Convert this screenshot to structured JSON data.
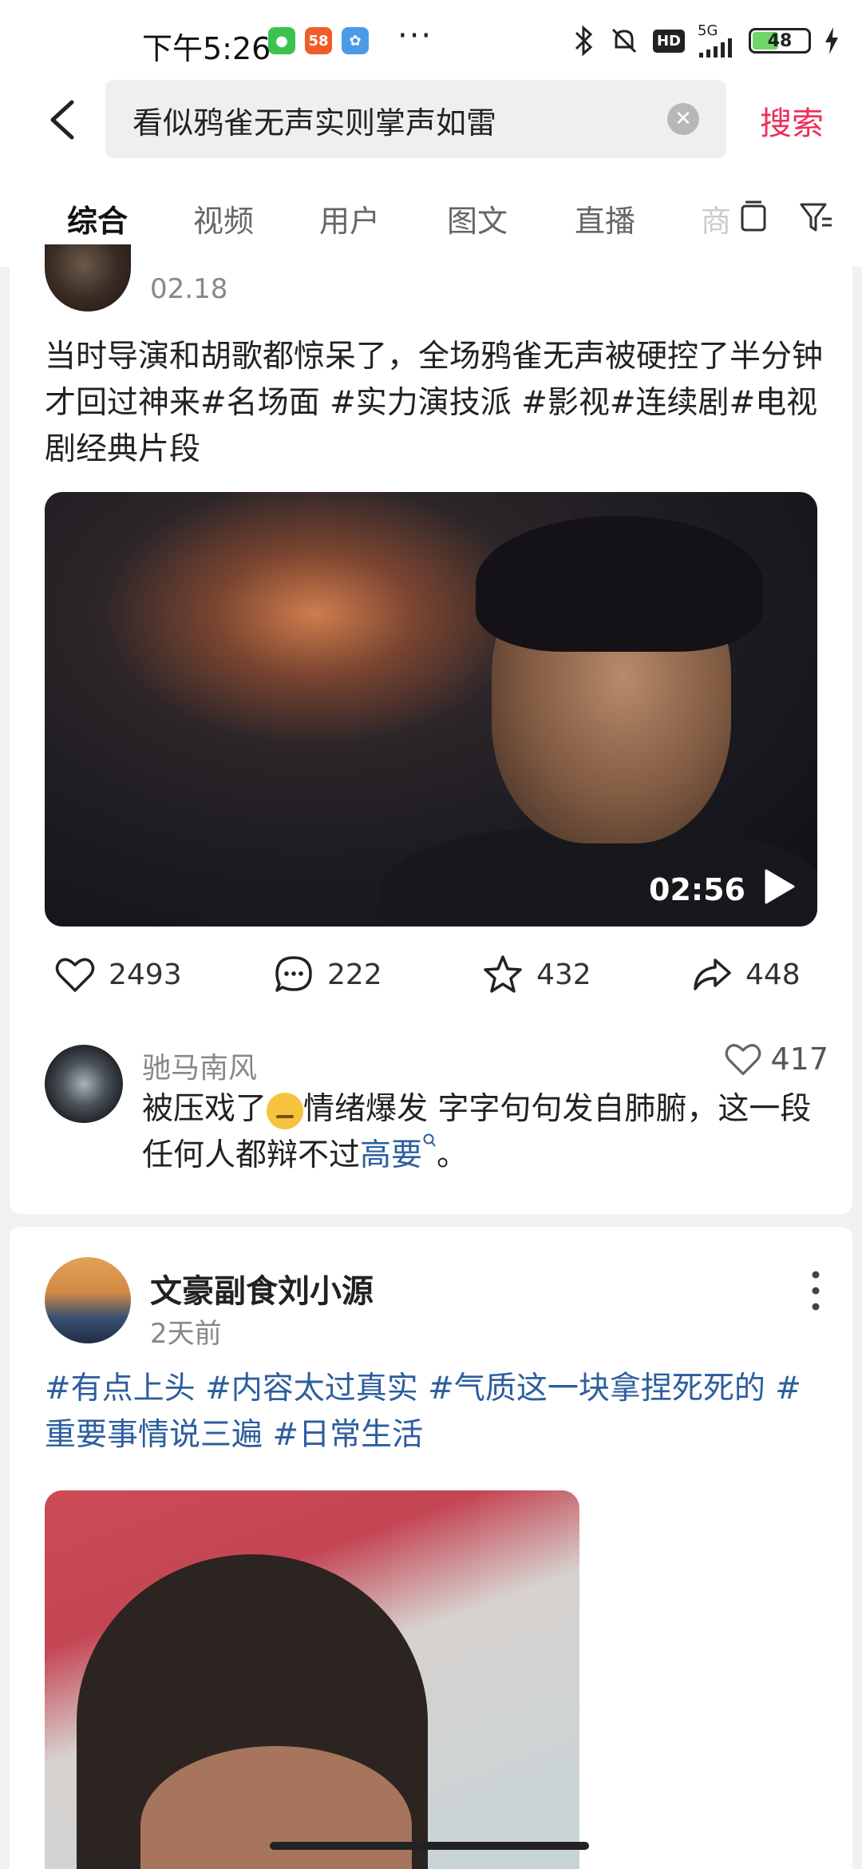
{
  "status_bar": {
    "time": "下午5:26",
    "app_icons": [
      {
        "name": "wechat-cat-icon",
        "label": "",
        "color": "#3cc24f"
      },
      {
        "name": "58-icon",
        "label": "58",
        "color": "#f25c28"
      },
      {
        "name": "cloud-app-icon",
        "label": "",
        "color": "#4a9be8"
      }
    ],
    "more": "···",
    "hd_badge": "HD",
    "network": "5G",
    "battery": "48"
  },
  "search": {
    "query": "看似鸦雀无声实则掌声如雷",
    "button_label": "搜索",
    "accent_color": "#ee2d5a"
  },
  "tabs": [
    "综合",
    "视频",
    "用户",
    "图文",
    "直播",
    "商"
  ],
  "post1": {
    "date": "02.18",
    "text": "当时导演和胡歌都惊呆了，全场鸦雀无声被硬控了半分钟才回过神来#名场面 #实力演技派 #影视#连续剧#电视剧经典片段",
    "video_duration": "02:56",
    "stats": {
      "likes": "2493",
      "comments": "222",
      "favorites": "432",
      "shares": "448"
    },
    "top_comment": {
      "author": "驰马南风",
      "likes": "417",
      "text_before": "被压戏了",
      "text_middle": "情绪爆发 字字句句发自肺腑，这一段任何人都辩不过",
      "link": "高要",
      "text_after": "。"
    }
  },
  "post2": {
    "author": "文豪副食刘小源",
    "time": "2天前",
    "hashtags": "#有点上头 #内容太过真实 #气质这一块拿捏死死的 #重要事情说三遍 #日常生活"
  }
}
